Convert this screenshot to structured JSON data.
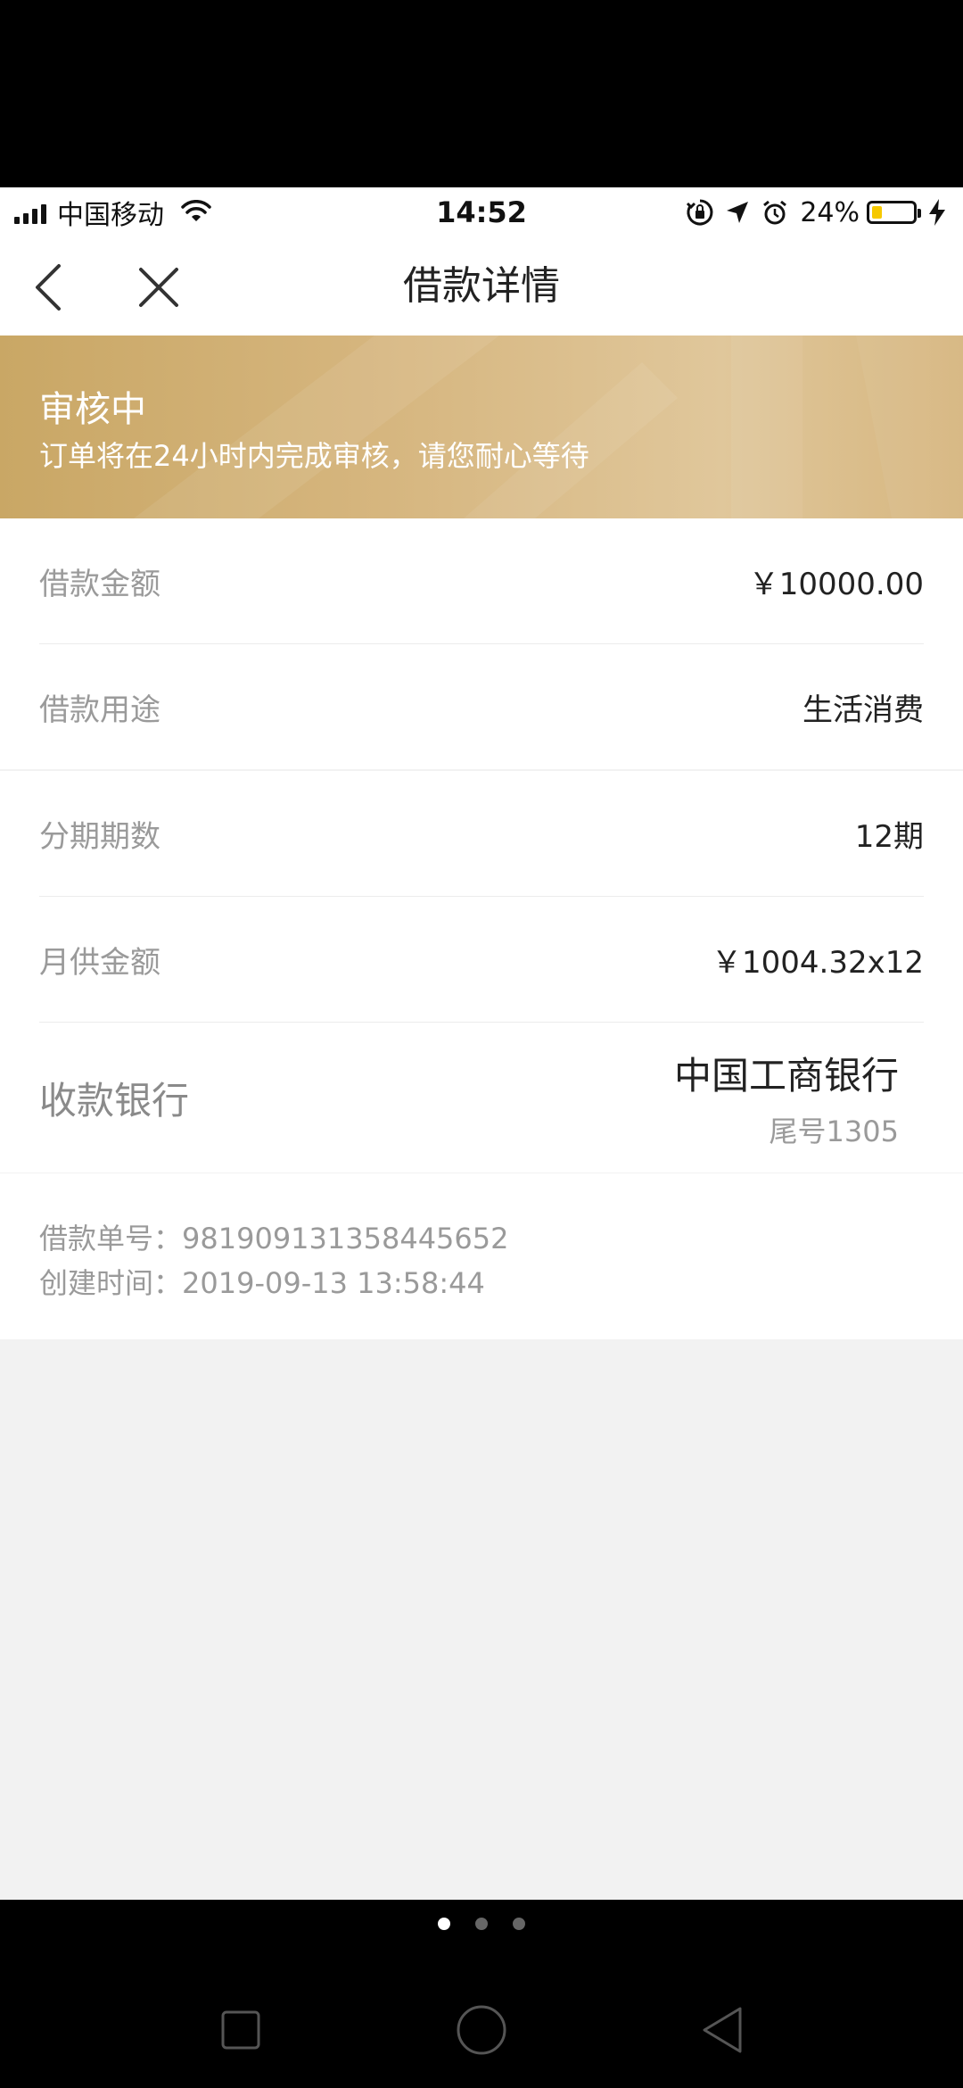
{
  "status_bar": {
    "carrier": "中国移动",
    "time": "14:52",
    "battery_percent": "24%",
    "battery_level": 0.24
  },
  "nav": {
    "title": "借款详情"
  },
  "banner": {
    "status": "审核中",
    "message": "订单将在24小时内完成审核，请您耐心等待"
  },
  "loan": {
    "amount_label": "借款金额",
    "amount_value": "￥10000.00",
    "purpose_label": "借款用途",
    "purpose_value": "生活消费",
    "installments_label": "分期期数",
    "installments_value": "12期",
    "monthly_label": "月供金额",
    "monthly_value": "￥1004.32x12",
    "bank_label": "收款银行",
    "bank_name": "中国工商银行",
    "bank_tail": "尾号1305"
  },
  "order": {
    "number_label": "借款单号：",
    "number_value": "981909131358445652",
    "created_label": "创建时间：",
    "created_value": "2019-09-13 13:58:44"
  },
  "colors": {
    "banner_gold": "#d6b67f",
    "page_bg": "#f2f2f2",
    "label_gray": "#9a9a9a"
  },
  "icons": {
    "back": "chevron-left-icon",
    "close": "close-icon",
    "home": "circle-home-icon",
    "recents": "square-recents-icon",
    "sys_back": "triangle-back-icon"
  }
}
